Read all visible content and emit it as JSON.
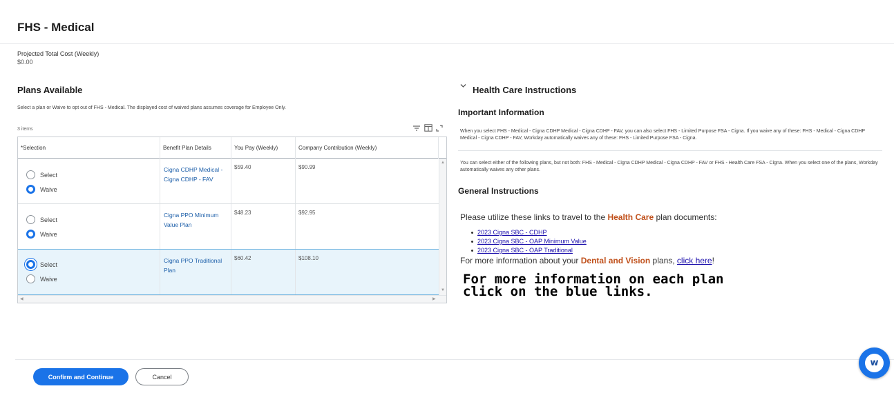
{
  "page": {
    "title": "FHS - Medical"
  },
  "cost": {
    "label": "Projected Total Cost (Weekly)",
    "value": "$0.00"
  },
  "plans": {
    "heading": "Plans Available",
    "description": "Select a plan or Waive to opt out of FHS - Medical. The displayed cost of waived plans assumes coverage for Employee Only.",
    "items_count": "3 items",
    "columns": [
      "*Selection",
      "Benefit Plan Details",
      "You Pay (Weekly)",
      "Company Contribution (Weekly)"
    ],
    "select_label": "Select",
    "waive_label": "Waive",
    "rows": [
      {
        "plan": "Cigna CDHP Medical - Cigna CDHP - FAV",
        "you_pay": "$59.40",
        "company": "$90.99",
        "choice": "Waive"
      },
      {
        "plan": "Cigna PPO Minimum Value Plan",
        "you_pay": "$48.23",
        "company": "$92.95",
        "choice": "Waive"
      },
      {
        "plan": "Cigna PPO Traditional Plan",
        "you_pay": "$60.42",
        "company": "$108.10",
        "choice": "Select"
      }
    ]
  },
  "health_care": {
    "heading": "Health Care Instructions",
    "important_heading": "Important Information",
    "important_p1": "When you select FHS - Medical - Cigna CDHP Medical - Cigna CDHP - FAV, you can also select FHS - Limited Purpose FSA - Cigna. If you waive any of these: FHS - Medical - Cigna CDHP Medical - Cigna CDHP - FAV, Workday automatically waives any of these: FHS - Limited Purpose FSA - Cigna.",
    "important_p2": "You can select either of the following plans, but not both: FHS - Medical - Cigna CDHP Medical - Cigna CDHP - FAV or FHS - Health Care FSA - Cigna. When you select one of the plans, Workday automatically waives any other plans.",
    "general_heading": "General Instructions",
    "util_before": "Please utilize these links to travel to the ",
    "util_highlight": "Health Care",
    "util_after": " plan documents:",
    "doc_links": [
      "2023 Cigna SBC - CDHP",
      "2023 Cigna SBC - OAP Minimum Value",
      "2023 Cigna SBC - OAP Traditional"
    ],
    "more_before": "For more information about your ",
    "more_highlight": "Dental and Vision",
    "more_middle": " plans, ",
    "more_link": "click here",
    "more_after": "!",
    "note_line1": "For more information on each plan",
    "note_line2": "click on the blue links."
  },
  "footer": {
    "confirm_label": "Confirm and Continue",
    "cancel_label": "Cancel"
  },
  "assistant": {
    "glyph": "w"
  },
  "colors": {
    "accent": "#1a73e8",
    "link": "#1a5da8",
    "highlight": "#c0501b",
    "selected_row": "#e8f4fb"
  },
  "icons": [
    "filter-icon",
    "column-layout-icon",
    "expand-icon",
    "chevron-down-icon",
    "workday-assistant-icon"
  ]
}
